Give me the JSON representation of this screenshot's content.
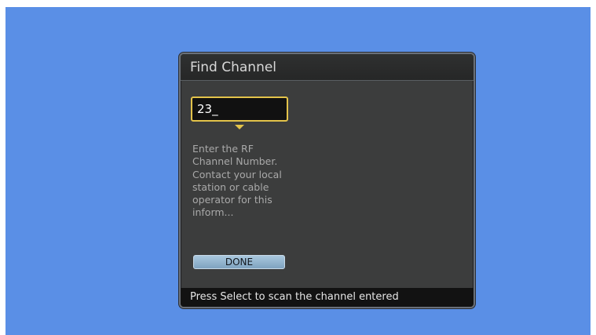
{
  "dialog": {
    "title": "Find Channel",
    "input_value": "23_",
    "help_text": "Enter the RF Channel Number. Contact your local station or cable operator for this inform...",
    "done_label": "DONE",
    "status": "Press Select to scan the channel entered"
  },
  "colors": {
    "background": "#5a8fe6",
    "dialog": "#3c3d3d",
    "focus": "#e3c34a",
    "button": "#93b6d1"
  }
}
